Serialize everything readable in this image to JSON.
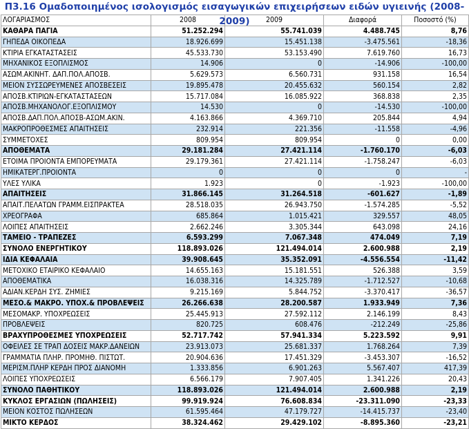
{
  "title": "Π3.16 Ομαδοποιημένος ισολογισμός εισαγωγικών επιχειρήσεων ειδών υγιεινής (2008-2009)",
  "header": [
    "ΛΟΓΑΡΙΑΣΜΟΣ",
    "2008",
    "2009",
    "Διαφορά",
    "Ποσοστό (%)"
  ],
  "rows": [
    {
      "label": "ΚΑΘΑΡΑ ΠΑΓΙΑ",
      "v2008": "51.252.294",
      "v2009": "55.741.039",
      "diff": "4.488.745",
      "pct": "8,76",
      "bold": true,
      "alt": false
    },
    {
      "label": "ΓΗΠΕΔΑ ΟΙΚΟΠΕΔΑ",
      "v2008": "18.926.699",
      "v2009": "15.451.138",
      "diff": "-3.475.561",
      "pct": "-18,36",
      "bold": false,
      "alt": true
    },
    {
      "label": "ΚΤΙΡΙΑ ΕΓΚΑΤΑΣΤΑΣΕΙΣ",
      "v2008": "45.533.730",
      "v2009": "53.153.490",
      "diff": "7.619.760",
      "pct": "16,73",
      "bold": false,
      "alt": false
    },
    {
      "label": "ΜΗΧΑΝΙΚΟΣ ΕΞΟΠΛΙΣΜΟΣ",
      "v2008": "14.906",
      "v2009": "0",
      "diff": "-14.906",
      "pct": "-100,00",
      "bold": false,
      "alt": true
    },
    {
      "label": "ΑΣΩΜ.ΑΚΙΝΗΤ. ΔΑΠ.ΠΟΛ.ΑΠΟΣΒ.",
      "v2008": "5.629.573",
      "v2009": "6.560.731",
      "diff": "931.158",
      "pct": "16,54",
      "bold": false,
      "alt": false
    },
    {
      "label": "ΜΕΙΟΝ ΣΥΣΣΩΡΕΥΜΕΝΕΣ ΑΠΟΣΒΕΣΕΙΣ",
      "v2008": "19.895.478",
      "v2009": "20.455.632",
      "diff": "560.154",
      "pct": "2,82",
      "bold": false,
      "alt": true
    },
    {
      "label": "ΑΠΟΣΒ.ΚΤΙΡΙΩΝ-ΕΓΚΑΤΑΣΤΑΣΕΩΝ",
      "v2008": "15.717.084",
      "v2009": "16.085.922",
      "diff": "368.838",
      "pct": "2,35",
      "bold": false,
      "alt": false
    },
    {
      "label": "ΑΠΟΣΒ.ΜΗΧΑΝΟΛΟΓ.ΕΞΟΠΛΙΣΜΟΥ",
      "v2008": "14.530",
      "v2009": "0",
      "diff": "-14.530",
      "pct": "-100,00",
      "bold": false,
      "alt": true
    },
    {
      "label": "ΑΠΟΣΒ.ΔΑΠ.ΠΟΛ.ΑΠΟΣΒ-ΑΣΩΜ.ΑΚΙΝ.",
      "v2008": "4.163.866",
      "v2009": "4.369.710",
      "diff": "205.844",
      "pct": "4,94",
      "bold": false,
      "alt": false
    },
    {
      "label": "ΜΑΚΡΟΠΡΟΘΕΣΜΕΣ ΑΠΑΙΤΗΣΕΙΣ",
      "v2008": "232.914",
      "v2009": "221.356",
      "diff": "-11.558",
      "pct": "-4,96",
      "bold": false,
      "alt": true
    },
    {
      "label": "ΣΥΜΜΕΤΟΧΕΣ",
      "v2008": "809.954",
      "v2009": "809.954",
      "diff": "0",
      "pct": "0,00",
      "bold": false,
      "alt": false
    },
    {
      "label": "ΑΠΟΘΕΜΑΤΑ",
      "v2008": "29.181.284",
      "v2009": "27.421.114",
      "diff": "-1.760.170",
      "pct": "-6,03",
      "bold": true,
      "alt": true
    },
    {
      "label": "ΕΤΟΙΜΑ ΠΡΟΙΟΝΤΑ ΕΜΠΟΡΕΥΜΑΤΑ",
      "v2008": "29.179.361",
      "v2009": "27.421.114",
      "diff": "-1.758.247",
      "pct": "-6,03",
      "bold": false,
      "alt": false
    },
    {
      "label": "ΗΜΙΚΑΤΕΡΓ.ΠΡΟΙΟΝΤΑ",
      "v2008": "0",
      "v2009": "0",
      "diff": "0",
      "pct": "-",
      "bold": false,
      "alt": true
    },
    {
      "label": "ΥΛΕΣ ΥΛΙΚΑ",
      "v2008": "1.923",
      "v2009": "0",
      "diff": "-1.923",
      "pct": "-100,00",
      "bold": false,
      "alt": false
    },
    {
      "label": "ΑΠΑΙΤΗΣΕΙΣ",
      "v2008": "31.866.145",
      "v2009": "31.264.518",
      "diff": "-601.627",
      "pct": "-1,89",
      "bold": true,
      "alt": true
    },
    {
      "label": "ΑΠΑΙΤ.ΠΕΛΑΤΩΝ ΓΡΑΜΜ.ΕΙΣΠΡΑΚΤΕΑ",
      "v2008": "28.518.035",
      "v2009": "26.943.750",
      "diff": "-1.574.285",
      "pct": "-5,52",
      "bold": false,
      "alt": false
    },
    {
      "label": "ΧΡΕΟΓΡΑΦΑ",
      "v2008": "685.864",
      "v2009": "1.015.421",
      "diff": "329.557",
      "pct": "48,05",
      "bold": false,
      "alt": true
    },
    {
      "label": "ΛΟΙΠΕΣ ΑΠΑΙΤΗΣΕΙΣ",
      "v2008": "2.662.246",
      "v2009": "3.305.344",
      "diff": "643.098",
      "pct": "24,16",
      "bold": false,
      "alt": false
    },
    {
      "label": "ΤΑΜΕΙΟ - ΤΡΑΠΕΖΕΣ",
      "v2008": "6.593.299",
      "v2009": "7.067.348",
      "diff": "474.049",
      "pct": "7,19",
      "bold": true,
      "alt": true
    },
    {
      "label": "ΣΥΝΟΛΟ ΕΝΕΡΓΗΤΙΚΟΥ",
      "v2008": "118.893.026",
      "v2009": "121.494.014",
      "diff": "2.600.988",
      "pct": "2,19",
      "bold": true,
      "alt": false
    },
    {
      "label": "ΙΔΙΑ ΚΕΦΑΛΑΙΑ",
      "v2008": "39.908.645",
      "v2009": "35.352.091",
      "diff": "-4.556.554",
      "pct": "-11,42",
      "bold": true,
      "alt": true
    },
    {
      "label": "ΜΕΤΟΧΙΚΟ ΕΤΑΙΡΙΚΟ ΚΕΦΑΛΑΙΟ",
      "v2008": "14.655.163",
      "v2009": "15.181.551",
      "diff": "526.388",
      "pct": "3,59",
      "bold": false,
      "alt": false
    },
    {
      "label": "ΑΠΟΘΕΜΑΤΙΚΑ",
      "v2008": "16.038.316",
      "v2009": "14.325.789",
      "diff": "-1.712.527",
      "pct": "-10,68",
      "bold": false,
      "alt": true
    },
    {
      "label": "ΑΔΙΑΝ.ΚΕΡΔΗ ΣΥΣ. ΖΗΜΙΕΣ",
      "v2008": "9.215.169",
      "v2009": "5.844.752",
      "diff": "-3.370.417",
      "pct": "-36,57",
      "bold": false,
      "alt": false
    },
    {
      "label": "ΜΕΣΟ.& ΜΑΚΡΟ. ΥΠΟΧ.& ΠΡΟΒΛΕΨΕΙΣ",
      "v2008": "26.266.638",
      "v2009": "28.200.587",
      "diff": "1.933.949",
      "pct": "7,36",
      "bold": true,
      "alt": true
    },
    {
      "label": "ΜΕΣΟΜΑΚΡ. ΥΠΟΧΡΕΩΣΕΙΣ",
      "v2008": "25.445.913",
      "v2009": "27.592.112",
      "diff": "2.146.199",
      "pct": "8,43",
      "bold": false,
      "alt": false
    },
    {
      "label": "ΠΡΟΒΛΕΨΕΙΣ",
      "v2008": "820.725",
      "v2009": "608.476",
      "diff": "-212.249",
      "pct": "-25,86",
      "bold": false,
      "alt": true
    },
    {
      "label": "ΒΡΑΧΥΠΡΟΘΕΣΜΕΣ ΥΠΟΧΡΕΩΣΕΙΣ",
      "v2008": "52.717.742",
      "v2009": "57.941.334",
      "diff": "5.223.592",
      "pct": "9,91",
      "bold": true,
      "alt": false
    },
    {
      "label": "ΟΦΕΙΛΕΣ ΣΕ ΤΡΑΠ ΔΟΣΕΙΣ ΜΑΚΡ.ΔΑΝΕΙΩΝ",
      "v2008": "23.913.073",
      "v2009": "25.681.337",
      "diff": "1.768.264",
      "pct": "7,39",
      "bold": false,
      "alt": true
    },
    {
      "label": "ΓΡΑΜΜΑΤΙΑ ΠΛΗΡ. ΠΡΟΜΗΘ. ΠΙΣΤΩΤ.",
      "v2008": "20.904.636",
      "v2009": "17.451.329",
      "diff": "-3.453.307",
      "pct": "-16,52",
      "bold": false,
      "alt": false
    },
    {
      "label": "ΜΕΡΙΣΜ.ΠΛΗΡ ΚΕΡΔΗ ΠΡΟΣ ΔΙΑΝΟΜΗ",
      "v2008": "1.333.856",
      "v2009": "6.901.263",
      "diff": "5.567.407",
      "pct": "417,39",
      "bold": false,
      "alt": true
    },
    {
      "label": "ΛΟΙΠΕΣ ΥΠΟΧΡΕΩΣΕΙΣ",
      "v2008": "6.566.179",
      "v2009": "7.907.405",
      "diff": "1.341.226",
      "pct": "20,43",
      "bold": false,
      "alt": false
    },
    {
      "label": "ΣΥΝΟΛΟ ΠΑΘΗΤΙΚΟΥ",
      "v2008": "118.893.026",
      "v2009": "121.494.014",
      "diff": "2.600.988",
      "pct": "2,19",
      "bold": true,
      "alt": true
    },
    {
      "label": "ΚΥΚΛΟΣ ΕΡΓΑΣΙΩΝ (ΠΩΛΗΣΕΙΣ)",
      "v2008": "99.919.924",
      "v2009": "76.608.834",
      "diff": "-23.311.090",
      "pct": "-23,33",
      "bold": true,
      "alt": false
    },
    {
      "label": "ΜΕΙΟΝ ΚΟΣΤΟΣ ΠΩΛΗΣΕΩΝ",
      "v2008": "61.595.464",
      "v2009": "47.179.727",
      "diff": "-14.415.737",
      "pct": "-23,40",
      "bold": false,
      "alt": true
    },
    {
      "label": "ΜΙΚΤΟ ΚΕΡΔΟΣ",
      "v2008": "38.324.462",
      "v2009": "29.429.102",
      "diff": "-8.895.360",
      "pct": "-23,21",
      "bold": true,
      "alt": false
    }
  ]
}
